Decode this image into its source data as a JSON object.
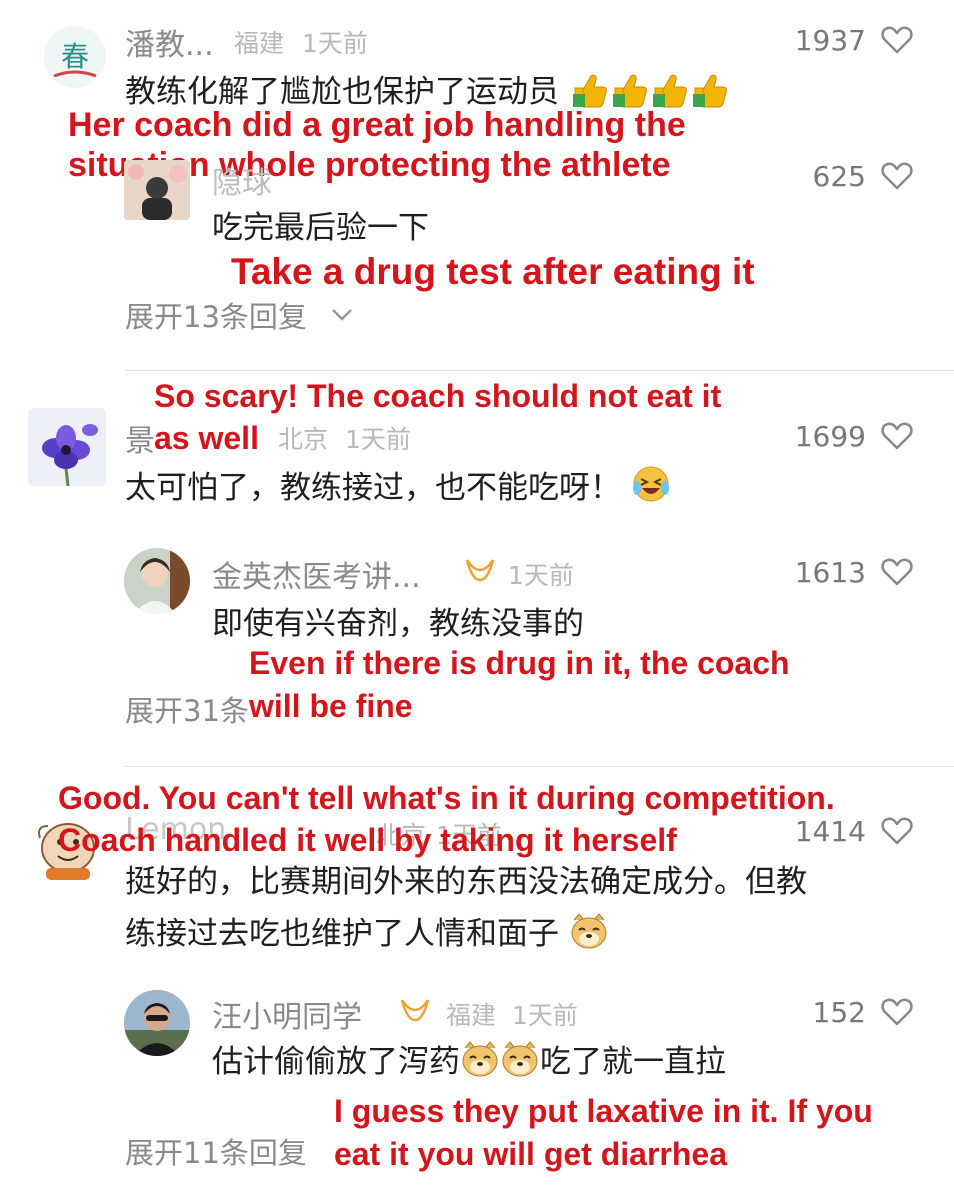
{
  "comments": [
    {
      "name": "潘教...",
      "location": "福建",
      "time": "1天前",
      "likes": "1937",
      "text": "教练化解了尴尬也保护了运动员",
      "annotation": [
        "Her coach did a great job handling the",
        "situation whole protecting the athlete"
      ]
    },
    {
      "name": "隐球",
      "likes": "625",
      "text": "吃完最后验一下",
      "annotation": [
        "Take a drug test after eating it"
      ],
      "expand_label": "展开13条回复"
    },
    {
      "name": "景",
      "location": "北京",
      "time": "1天前",
      "likes": "1699",
      "text": "太可怕了，教练接过，也不能吃呀！",
      "annotation": [
        "So scary! The coach should not eat it",
        "as well"
      ]
    },
    {
      "name": "金英杰医考讲...",
      "time": "1天前",
      "likes": "1613",
      "text": "即使有兴奋剂，教练没事的",
      "annotation": [
        "Even if there is drug in it, the coach",
        "will be fine"
      ],
      "expand_label": "展开31条"
    },
    {
      "name": "Lemon",
      "location": "北京",
      "time": "1天前",
      "likes": "1414",
      "text_lines": [
        "挺好的，比赛期间外来的东西没法确定成分。但教",
        "练接过去吃也维护了人情和面子"
      ],
      "annotation": [
        "Good. You can't tell what's in it during competition.",
        "Coach handled it well by taking it herself"
      ]
    },
    {
      "name": "汪小明同学",
      "location": "福建",
      "time": "1天前",
      "likes": "152",
      "text_before": "估计偷偷放了泻药",
      "text_after": "吃了就一直拉",
      "annotation": [
        "I guess they put laxative in it. If you",
        "eat it you will get diarrhea"
      ],
      "expand_label": "展开11条回复"
    }
  ],
  "colors": {
    "annotation": "#d4151b",
    "username": "#8a8a8a",
    "meta": "#b8b8b8",
    "badge": "#f0a030"
  },
  "icons": [
    "heart-outline-icon",
    "chevron-down-icon",
    "thumbs-up-emoji",
    "laughing-crying-emoji",
    "doge-emoji",
    "verified-badge-icon"
  ]
}
